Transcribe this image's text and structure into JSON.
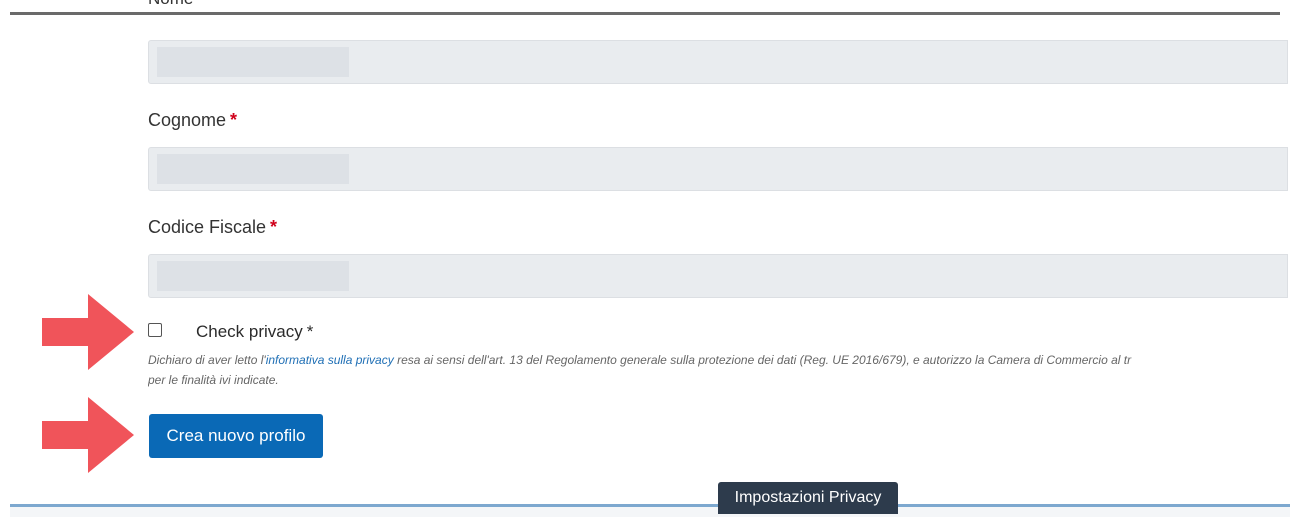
{
  "form": {
    "nome_label": "Nome",
    "cognome_label": "Cognome",
    "codice_fiscale_label": "Codice Fiscale",
    "required_marker": "*",
    "check_privacy_label": "Check privacy",
    "check_privacy_required": "*",
    "check_privacy_checked": false,
    "privacy_text_before": "Dichiaro di aver letto l'",
    "privacy_link": "informativa sulla privacy",
    "privacy_text_after": " resa ai sensi dell'art. 13 del Regolamento generale sulla protezione dei dati (Reg. UE 2016/679), e autorizzo la Camera di Commercio al tr",
    "privacy_text_line2": "per le finalità ivi indicate.",
    "submit_label": "Crea nuovo profilo"
  },
  "footer": {
    "privacy_settings_label": "Impostazioni Privacy"
  },
  "colors": {
    "primary_button": "#0a69b6",
    "arrow": "#f0545a",
    "required": "#d0021b",
    "privacy_tab": "#2d3b4c"
  }
}
